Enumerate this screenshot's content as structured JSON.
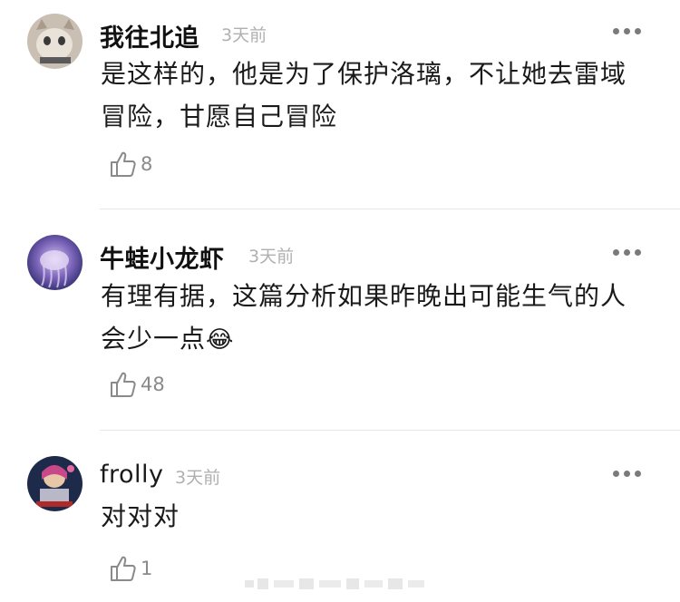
{
  "comments": [
    {
      "username": "我往北追",
      "time": "3天前",
      "text": "是这样的，他是为了保护洛璃，不让她去雷域冒险，甘愿自己冒险",
      "likes": "8"
    },
    {
      "username": "牛蛙小龙虾",
      "time": "3天前",
      "text": "有理有据，这篇分析如果昨晚出可能生气的人会少一点",
      "emoji": "😂",
      "likes": "48"
    },
    {
      "username": "frolly",
      "time": "3天前",
      "text": "对对对",
      "likes": "1"
    }
  ],
  "icons": {
    "more": "more-dots-icon",
    "like": "thumbs-up-icon",
    "emoji": "tears-of-joy-emoji"
  },
  "colors": {
    "username": "#111111",
    "time": "#b0b0b0",
    "text": "#1a1a1a",
    "like": "#8a8a8a",
    "divider": "#e6e6e6"
  }
}
